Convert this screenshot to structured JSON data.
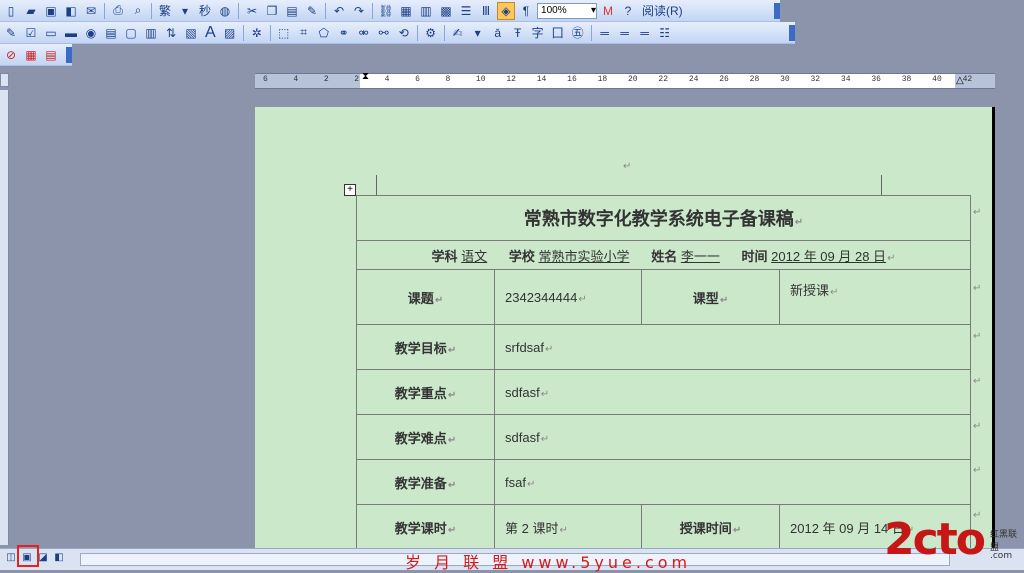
{
  "toolbar1": {
    "trad_chinese_label": "繁",
    "zoom": "100%",
    "read_label": "阅读(R)"
  },
  "toolbar2": {
    "font_a_label": "A"
  },
  "ruler": {
    "ticks": [
      "6",
      "4",
      "2",
      "2",
      "4",
      "6",
      "8",
      "10",
      "12",
      "14",
      "16",
      "18",
      "20",
      "22",
      "24",
      "26",
      "28",
      "30",
      "32",
      "34",
      "36",
      "38",
      "40",
      "42"
    ]
  },
  "document": {
    "title": "常熟市数字化教学系统电子备课稿",
    "subject_label": "学科",
    "subject_value": "语文",
    "school_label": "学校",
    "school_value": "常熟市实验小学",
    "name_label": "姓名",
    "name_value": "李一一",
    "time_label": "时间",
    "time_value": "2012 年 09 月 28 日",
    "para_mark": "↵",
    "rows": [
      {
        "label": "课题",
        "value": "2342344444",
        "label2": "课型",
        "value2": "新授课"
      },
      {
        "label": "教学目标",
        "value": "srfdsaf"
      },
      {
        "label": "教学重点",
        "value": "sdfasf"
      },
      {
        "label": "教学难点",
        "value": "sdfasf"
      },
      {
        "label": "教学准备",
        "value": "fsaf"
      },
      {
        "label": "教学课时",
        "value": "第 2 课时",
        "label2": "授课时间",
        "value2": "2012 年 09 月 14 日"
      }
    ]
  },
  "status": {
    "watermark": "岁 月 联 盟  www.5yue.com",
    "logo": "2cto",
    "logo_small": "红黑联盟",
    "logo_domain": ".com"
  },
  "colors": {
    "page_bg": "#cbe8cb",
    "toolbar_bg": "#c3d5f3",
    "workspace_bg": "#8b94aa"
  }
}
